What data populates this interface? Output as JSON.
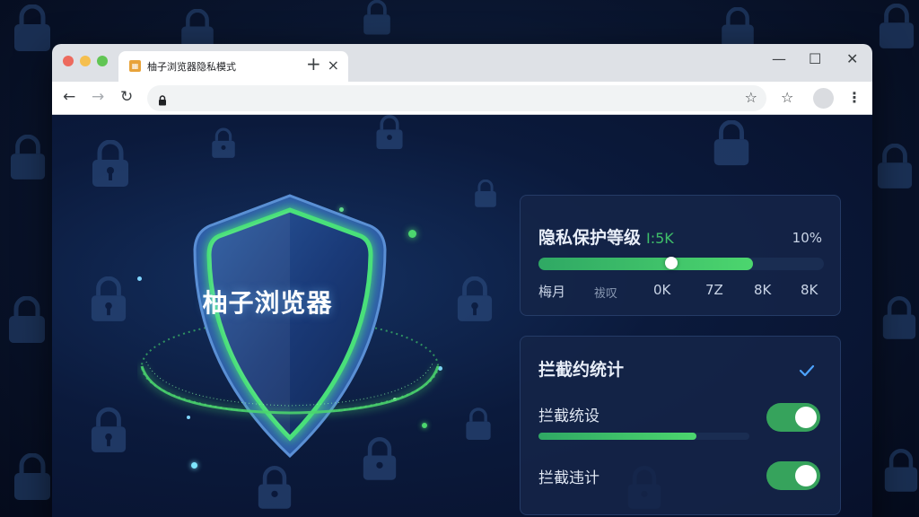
{
  "browser": {
    "tab_title": "柚子浏览器隐私模式",
    "tab_favicon": "favicon-icon",
    "new_tab_label": "+",
    "close_tab_label": "×",
    "window_controls": {
      "minimize": "—",
      "maximize": "☐",
      "close": "✕"
    },
    "address": "",
    "traffic_lights": [
      "#ed6a5e",
      "#f5bf4f",
      "#61c554"
    ]
  },
  "hero": {
    "shield_label": "柚子浏览器",
    "shield_icon": "shield-icon",
    "accent_color": "#49e07a"
  },
  "privacy_panel": {
    "title": "隐私保护等级",
    "title_extra": "I:5K",
    "percent": "10%",
    "level": 0.75,
    "ticks": [
      "梅月",
      "祓叹",
      "0K",
      "7Z",
      "8K",
      "8K"
    ]
  },
  "block_panel": {
    "title": "拦截约统计",
    "check_icon": "check-icon",
    "rows": [
      {
        "label": "拦截统设",
        "enabled": true,
        "progress": 0.75
      },
      {
        "label": "拦截违计",
        "enabled": true
      }
    ]
  },
  "colors": {
    "green": "#4cd66e",
    "toggle_on": "#36a35c",
    "panel_bg": "#142448"
  }
}
